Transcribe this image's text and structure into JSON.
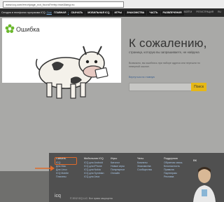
{
  "browser": {
    "url": "www.icq.com/error/page_not_found?retry=true&lang=ru"
  },
  "topbar": {
    "notice": "Сегодня в телефонах программа ICQ.",
    "notice_link": "Скачать бесплатно",
    "nav": [
      "ГЛАВНАЯ",
      "СКАЧАТЬ",
      "МОБИЛЬНАЯ ICQ",
      "ИГРЫ",
      "ЗНАКОМСТВА",
      "ЧАСТЬ",
      "РАЗВЛЕЧЕНИЯ"
    ],
    "right": [
      "ВОЙТИ",
      "РЕГИСТРАЦИЯ",
      "RU"
    ]
  },
  "error_card": {
    "title": "Ошибка"
  },
  "main": {
    "heading": "К сожалению,",
    "sub": "страница, которую вы запрашиваете, не найдена",
    "sub2": "Возможно, вы ошиблись при наборе адреса или перешли по неверной ссылке.",
    "link": "Вернуться на главную",
    "search_button": "Поиск"
  },
  "footer": {
    "columns": [
      {
        "head": "Скачать",
        "items": [
          "ICQ",
          "Для Mac",
          "Для Linux",
          "ICQ Mobile",
          "Плагины"
        ]
      },
      {
        "head": "Мобильная ICQ",
        "items": [
          "ICQ для Android",
          "ICQ для iPhone",
          "ICQ для Nokia",
          "ICQ для Symbian",
          "ICQ для Java"
        ]
      },
      {
        "head": "Игры",
        "items": [
          "Каталог",
          "Новые игры",
          "Популярное",
          "Онлайн"
        ]
      },
      {
        "head": "Чаты",
        "items": [
          "Комнаты",
          "Знакомства",
          "Сообщества"
        ]
      },
      {
        "head": "Поддержка",
        "items": [
          "Обратная связь",
          "Безопасность",
          "Правила",
          "Партнерам",
          "Реклама"
        ]
      }
    ],
    "social": "ВК",
    "logo": "icq",
    "copyright": "© 2012 ICQ LLC. Все права защищены"
  },
  "colors": {
    "accent": "#e6b817",
    "highlight": "#e06a2a",
    "footer_bg": "#505050"
  }
}
